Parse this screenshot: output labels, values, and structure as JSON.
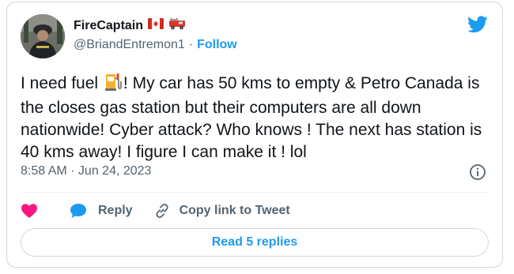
{
  "author": {
    "display_name": "FireCaptain",
    "handle": "@BriandEntremon1",
    "separator": "·",
    "follow_label": "Follow"
  },
  "tweet": {
    "text_before_emoji": "I need fuel ",
    "text_after_emoji": "! My car has 50 kms to empty & Petro Canada is the closes gas station but their computers are all down nationwide! Cyber attack? Who knows ! The next has station is 40 kms away! I figure I can make it ! lol",
    "timestamp": "8:58 AM · Jun 24, 2023"
  },
  "actions": {
    "reply_label": "Reply",
    "copy_link_label": "Copy link to Tweet",
    "read_replies_label": "Read 5 replies"
  },
  "icons": {
    "brand": "twitter-bird-icon",
    "like": "heart-icon",
    "reply": "speech-bubble-icon",
    "copy": "link-icon",
    "info": "info-icon",
    "flags": [
      "canada-flag-icon",
      "fire-engine-icon"
    ],
    "fuel": "fuel-pump-icon"
  },
  "colors": {
    "accent": "#1d9bf0",
    "like": "#f91880",
    "text": "#0f1419",
    "muted": "#536471",
    "border": "#cfd9de"
  }
}
